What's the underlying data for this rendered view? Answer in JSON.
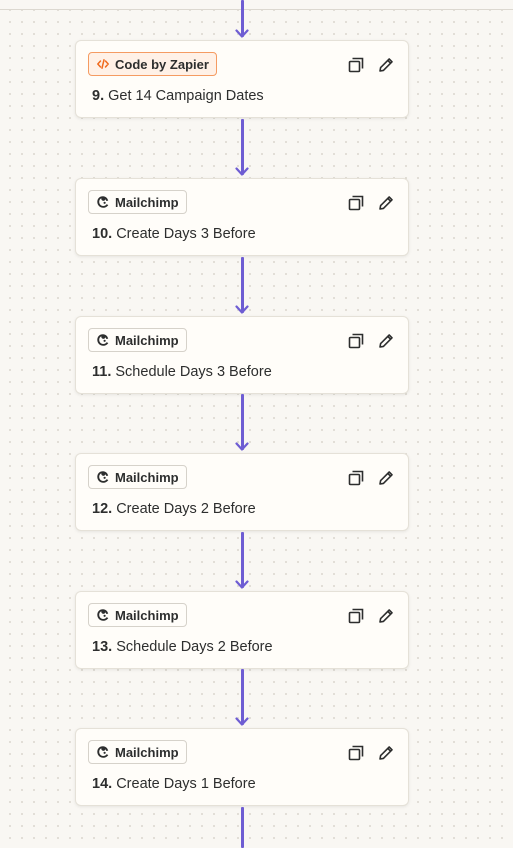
{
  "steps": [
    {
      "number": "9.",
      "title": "Get 14 Campaign Dates",
      "app": "Code by Zapier",
      "app_icon": "code-icon"
    },
    {
      "number": "10.",
      "title": "Create Days 3 Before",
      "app": "Mailchimp",
      "app_icon": "mailchimp-icon"
    },
    {
      "number": "11.",
      "title": "Schedule Days 3 Before",
      "app": "Mailchimp",
      "app_icon": "mailchimp-icon"
    },
    {
      "number": "12.",
      "title": "Create Days 2 Before",
      "app": "Mailchimp",
      "app_icon": "mailchimp-icon"
    },
    {
      "number": "13.",
      "title": "Schedule Days 2 Before",
      "app": "Mailchimp",
      "app_icon": "mailchimp-icon"
    },
    {
      "number": "14.",
      "title": "Create Days 1 Before",
      "app": "Mailchimp",
      "app_icon": "mailchimp-icon"
    }
  ],
  "colors": {
    "connector": "#6e5dd3",
    "code_badge_border": "#f59b62",
    "code_badge_bg": "#fff1e7",
    "code_icon": "#f06a1d",
    "text": "#2d2e2e",
    "canvas": "#f9f7f3",
    "card_bg": "#fffdf9"
  },
  "icons": {
    "duplicate": "duplicate-icon",
    "edit": "pencil-icon"
  }
}
